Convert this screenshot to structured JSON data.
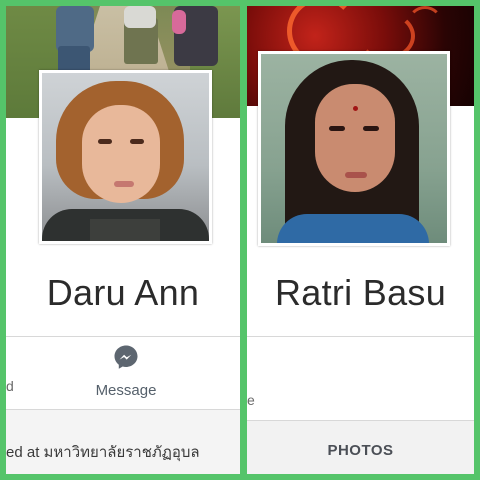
{
  "left_profile": {
    "name": "Daru Ann",
    "message_label": "Message",
    "cut_letter": "d",
    "about_text": "ed at มหาวิทยาลัยราชภัฏอุบล"
  },
  "right_profile": {
    "name": "Ratri Basu",
    "cut_letter": "e",
    "photos_tab": "PHOTOS"
  },
  "colors": {
    "background_border": "#55c46a",
    "messenger_accent": "#5d6670",
    "cover_right": "#7a0d0a"
  },
  "icons": [
    "messenger-icon"
  ]
}
